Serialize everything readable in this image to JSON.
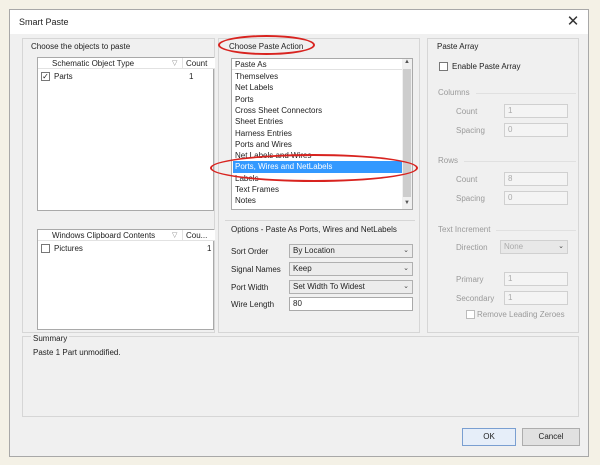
{
  "dialog": {
    "title": "Smart Paste",
    "close_glyph": "✕"
  },
  "objects": {
    "title": "Choose the objects to paste",
    "schematic_table": {
      "col1": "Schematic Object Type",
      "col2": "Count",
      "rows": [
        {
          "name": "Parts",
          "count": "1",
          "checked": true
        }
      ]
    },
    "clipboard_table": {
      "col1": "Windows Clipboard Contents",
      "col2": "Cou...",
      "rows": [
        {
          "name": "Pictures",
          "count": "1",
          "checked": false
        }
      ]
    }
  },
  "paste_action": {
    "title": "Choose Paste Action",
    "list_header": "Paste As",
    "items": [
      "Themselves",
      "Net Labels",
      "Ports",
      "Cross Sheet Connectors",
      "Sheet Entries",
      "Harness Entries",
      "Ports and Wires",
      "Net Labels and Wires",
      "Ports, Wires and NetLabels",
      "Labels",
      "Text Frames",
      "Notes"
    ],
    "selected": "Ports, Wires and NetLabels"
  },
  "options": {
    "title": "Options - Paste As Ports, Wires and NetLabels",
    "sort_order_label": "Sort Order",
    "sort_order_value": "By Location",
    "signal_names_label": "Signal Names",
    "signal_names_value": "Keep",
    "port_width_label": "Port Width",
    "port_width_value": "Set Width To Widest",
    "wire_length_label": "Wire Length",
    "wire_length_value": "80"
  },
  "paste_array": {
    "title": "Paste Array",
    "enable_label": "Enable Paste Array",
    "columns_title": "Columns",
    "count_label": "Count",
    "columns_count": "1",
    "spacing_label": "Spacing",
    "columns_spacing": "0",
    "rows_title": "Rows",
    "rows_count": "8",
    "rows_spacing": "0",
    "text_increment_title": "Text Increment",
    "direction_label": "Direction",
    "direction_value": "None",
    "primary_label": "Primary",
    "primary_value": "1",
    "secondary_label": "Secondary",
    "secondary_value": "1",
    "remove_zeroes_label": "Remove Leading Zeroes"
  },
  "summary": {
    "title": "Summary",
    "text": "Paste 1 Part unmodified."
  },
  "footer": {
    "ok_label": "OK",
    "cancel_label": "Cancel"
  },
  "colors": {
    "selection": "#3399ff",
    "annotation_red": "#d8231f"
  }
}
